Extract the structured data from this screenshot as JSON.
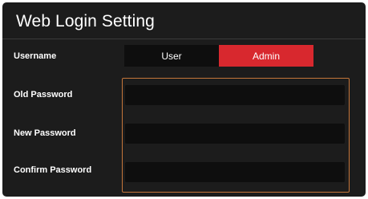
{
  "title": "Web Login Setting",
  "labels": {
    "username": "Username",
    "old_password": "Old Password",
    "new_password": "New Password",
    "confirm_password": "Confirm Password"
  },
  "username_options": [
    "User",
    "Admin"
  ],
  "selected_username": "Admin",
  "inputs": {
    "old_password": "",
    "new_password": "",
    "confirm_password": ""
  },
  "colors": {
    "panel_bg": "#1c1c1c",
    "input_bg": "#0e0e0e",
    "accent_red": "#d8282e",
    "focus_border": "#c4753a"
  }
}
